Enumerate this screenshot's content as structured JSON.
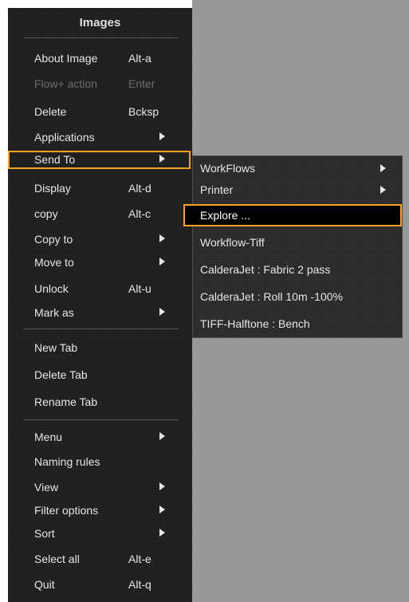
{
  "menu": {
    "title": "Images",
    "items": [
      {
        "label": "About Image",
        "shortcut": "Alt-a"
      },
      {
        "label": "Flow+ action",
        "shortcut": "Enter",
        "disabled": true
      },
      {
        "label": "Delete",
        "shortcut": "Bcksp"
      },
      {
        "label": "Applications",
        "submenu": true
      },
      {
        "label": "Send To",
        "submenu": true,
        "active": true
      },
      {
        "label": "Display",
        "shortcut": "Alt-d"
      },
      {
        "label": "copy",
        "shortcut": "Alt-c"
      },
      {
        "label": "Copy to",
        "submenu": true
      },
      {
        "label": "Move to",
        "submenu": true
      },
      {
        "label": "Unlock",
        "shortcut": "Alt-u"
      },
      {
        "label": "Mark as",
        "submenu": true
      },
      {
        "label": "New Tab"
      },
      {
        "label": "Delete Tab"
      },
      {
        "label": "Rename Tab"
      },
      {
        "label": "Menu",
        "submenu": true
      },
      {
        "label": "Naming rules"
      },
      {
        "label": "View",
        "submenu": true
      },
      {
        "label": "Filter options",
        "submenu": true
      },
      {
        "label": "Sort",
        "submenu": true
      },
      {
        "label": "Select all",
        "shortcut": "Alt-e"
      },
      {
        "label": "Quit",
        "shortcut": "Alt-q"
      }
    ]
  },
  "submenu": {
    "items": [
      {
        "label": "WorkFlows",
        "submenu": true
      },
      {
        "label": "Printer",
        "submenu": true
      },
      {
        "label": "Explore ...",
        "selected": true
      },
      {
        "label": "Workflow-Tiff"
      },
      {
        "label": "CalderaJet : Fabric 2 pass"
      },
      {
        "label": "CalderaJet : Roll 10m -100%"
      },
      {
        "label": "TIFF-Halftone : Bench"
      }
    ]
  },
  "colors": {
    "menu_bg": "#1e1e1e",
    "canvas_bg": "#989898",
    "highlight_border": "#f4a21f",
    "text": "#e6e6e6",
    "disabled_text": "#6c6c6c"
  }
}
